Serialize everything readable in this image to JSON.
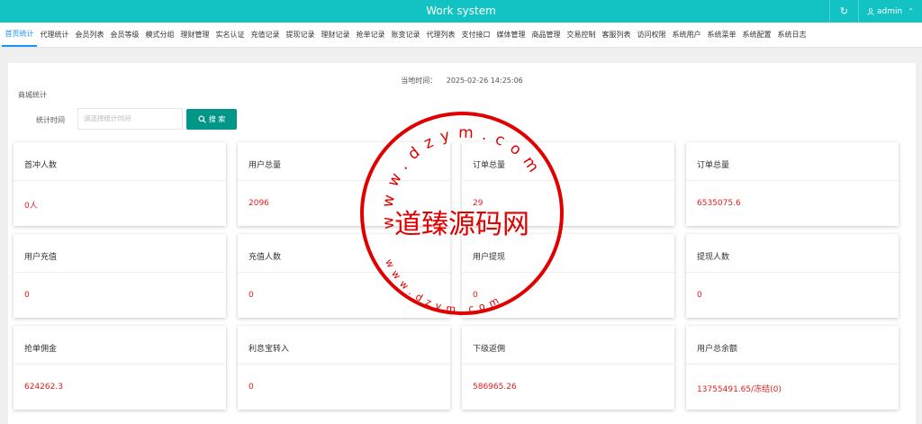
{
  "header": {
    "title": "Work system",
    "refresh_icon": "refresh-icon",
    "user_name": "admin"
  },
  "nav": {
    "tabs": [
      {
        "label": "首页统计",
        "active": true
      },
      {
        "label": "代理统计"
      },
      {
        "label": "会员列表"
      },
      {
        "label": "会员等级"
      },
      {
        "label": "模式分组"
      },
      {
        "label": "理财管理"
      },
      {
        "label": "实名认证"
      },
      {
        "label": "充值记录"
      },
      {
        "label": "提现记录"
      },
      {
        "label": "理财记录"
      },
      {
        "label": "抢单记录"
      },
      {
        "label": "账变记录"
      },
      {
        "label": "代理列表"
      },
      {
        "label": "支付接口"
      },
      {
        "label": "媒体管理"
      },
      {
        "label": "商品管理"
      },
      {
        "label": "交易控制"
      },
      {
        "label": "客服列表"
      },
      {
        "label": "访问权限"
      },
      {
        "label": "系统用户"
      },
      {
        "label": "系统菜单"
      },
      {
        "label": "系统配置"
      },
      {
        "label": "系统日志"
      }
    ]
  },
  "main": {
    "time_label": "当地时间：",
    "time_value": "2025-02-26 14:25:06",
    "section_title": "商城统计",
    "filter_label": "统计时间",
    "filter_placeholder": "请选择统计时间",
    "search_label": "搜 索"
  },
  "cards": [
    {
      "label": "首冲人数",
      "value": "0人"
    },
    {
      "label": "用户总量",
      "value": "2096"
    },
    {
      "label": "订单总量",
      "value": "29"
    },
    {
      "label": "订单总量",
      "value": "6535075.6"
    },
    {
      "label": "用户充值",
      "value": "0"
    },
    {
      "label": "充值人数",
      "value": "0"
    },
    {
      "label": "用户提现",
      "value": "0"
    },
    {
      "label": "提现人数",
      "value": "0"
    },
    {
      "label": "抢单佣金",
      "value": "624262.3"
    },
    {
      "label": "利息宝转入",
      "value": "0"
    },
    {
      "label": "下级返佣",
      "value": "586965.26"
    },
    {
      "label": "用户总余额",
      "value": "13755491.65/冻结(0)"
    }
  ],
  "watermark": {
    "center_text": "道臻源码网",
    "upper_arc": "www.dzym.com",
    "lower_arc": "www.dzym.com"
  },
  "colors": {
    "topbar": "#13c2c2",
    "active_tab": "#1890ff",
    "search_button": "#009688",
    "value_text": "#e02020",
    "stamp": "#e00000"
  }
}
